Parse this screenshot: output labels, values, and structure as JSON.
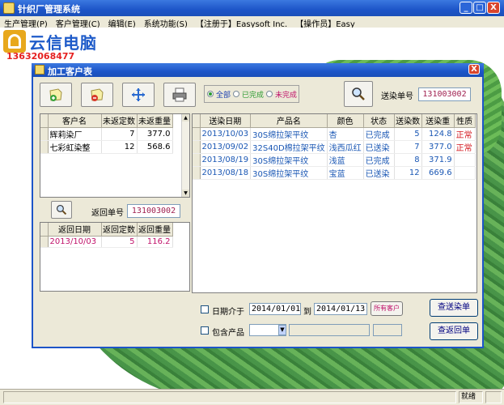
{
  "app": {
    "title": "针织厂管理系统",
    "window_buttons": {
      "minimize": "_",
      "maximize": "□",
      "close": "X"
    }
  },
  "menu": [
    "生产管理(P)",
    "客户管理(C)",
    "编辑(E)",
    "系统功能(S)",
    "【注册于】Easysoft Inc.",
    "【操作员】Easy"
  ],
  "logo": {
    "name": "云信电脑",
    "phone": "13632068477"
  },
  "dialog": {
    "title": "加工客户表",
    "close": "X",
    "toolbar": {
      "add_icon": "add-doc-icon",
      "remove_icon": "remove-doc-icon",
      "move_icon": "move-arrows-icon",
      "print_icon": "printer-icon",
      "search_icon": "magnifier-icon"
    },
    "filter": {
      "options": [
        "全部",
        "已完成",
        "未完成"
      ],
      "selected": "全部"
    },
    "send_no_label": "送染单号",
    "send_no": "131003002",
    "customers": {
      "headers": [
        "客户名",
        "未返定数",
        "未返重量"
      ],
      "rows": [
        {
          "name": "辉莉染厂",
          "pending_count": "7",
          "pending_weight": "377.0"
        },
        {
          "name": "七彩虹染整",
          "pending_count": "12",
          "pending_weight": "568.6"
        }
      ]
    },
    "return_no_label": "返回单号",
    "return_no": "131003002",
    "returns": {
      "headers": [
        "返回日期",
        "返回定数",
        "返回重量"
      ],
      "rows": [
        {
          "date": "2013/10/03",
          "count": "5",
          "weight": "116.2"
        }
      ]
    },
    "sends": {
      "headers": [
        "送染日期",
        "产品名",
        "颜色",
        "状态",
        "送染数",
        "送染重",
        "性质"
      ],
      "rows": [
        {
          "date": "2013/10/03",
          "product": "30S绵拉架平纹",
          "color": "杏",
          "status": "已完成",
          "count": "5",
          "weight": "124.8",
          "nature": "正常"
        },
        {
          "date": "2013/09/02",
          "product": "32S40D棉拉架平纹",
          "color": "浅西瓜红",
          "status": "已送染",
          "count": "7",
          "weight": "377.0",
          "nature": "正常"
        },
        {
          "date": "2013/08/19",
          "product": "30S绵拉架平纹",
          "color": "浅蓝",
          "status": "已完成",
          "count": "8",
          "weight": "371.9",
          "nature": ""
        },
        {
          "date": "2013/08/18",
          "product": "30S绵拉架平纹",
          "color": "宝蓝",
          "status": "已送染",
          "count": "12",
          "weight": "669.6",
          "nature": ""
        }
      ]
    },
    "date_filter": {
      "label": "日期介于",
      "from": "2014/01/01",
      "to_label": "到",
      "to": "2014/01/13",
      "all_customers": "所有客户"
    },
    "product_filter": {
      "label": "包含产品",
      "value": ""
    },
    "buttons": {
      "query_send": "查送染单",
      "query_return": "查返回单"
    }
  },
  "status": {
    "right": "就绪"
  }
}
